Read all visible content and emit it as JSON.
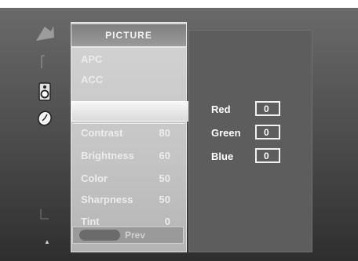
{
  "menu": {
    "title": "PICTURE",
    "items": [
      {
        "label": "APC",
        "value": ""
      },
      {
        "label": "ACC",
        "value": ""
      },
      {
        "label": "",
        "value": ""
      },
      {
        "label": "Contrast",
        "value": "80"
      },
      {
        "label": "Brightness",
        "value": "60"
      },
      {
        "label": "Color",
        "value": "50"
      },
      {
        "label": "Sharpness",
        "value": "50"
      },
      {
        "label": "Tint",
        "value": "0"
      }
    ],
    "prev_label": "Prev"
  },
  "submenu": {
    "rows": [
      {
        "label": "Red",
        "value": "0"
      },
      {
        "label": "Green",
        "value": "0"
      },
      {
        "label": "Blue",
        "value": "0"
      }
    ]
  },
  "icons": [
    "picture-icon",
    "screen-icon",
    "speaker-icon",
    "clock-icon",
    "lock-icon",
    "arrow-icon"
  ],
  "colors": {
    "screen_bg": "#4a4a4a",
    "menu_bg": "#c4c4c4",
    "submenu_bg": "#5d5d5d",
    "text": "#ffffff"
  }
}
